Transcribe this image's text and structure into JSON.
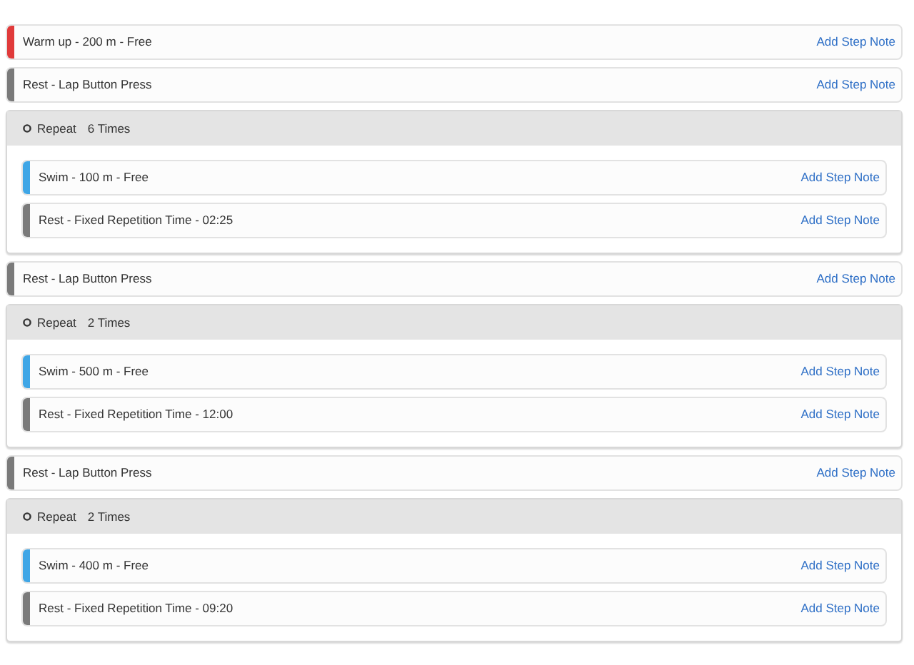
{
  "workout": [
    {
      "kind": "step",
      "label": "Warm up - 200 m - Free",
      "color": "#e03a3a",
      "note_link": "Add Step Note"
    },
    {
      "kind": "step",
      "label": "Rest - Lap Button Press",
      "color": "#7a7a7a",
      "note_link": "Add Step Note"
    },
    {
      "kind": "repeat",
      "label": "Repeat",
      "count": "6 Times",
      "children": [
        {
          "kind": "step",
          "label": "Swim - 100 m - Free",
          "color": "#3fa6e6",
          "note_link": "Add Step Note"
        },
        {
          "kind": "step",
          "label": "Rest - Fixed Repetition Time - 02:25",
          "color": "#7a7a7a",
          "note_link": "Add Step Note"
        }
      ]
    },
    {
      "kind": "step",
      "label": "Rest - Lap Button Press",
      "color": "#7a7a7a",
      "note_link": "Add Step Note"
    },
    {
      "kind": "repeat",
      "label": "Repeat",
      "count": "2 Times",
      "children": [
        {
          "kind": "step",
          "label": "Swim - 500 m - Free",
          "color": "#3fa6e6",
          "note_link": "Add Step Note"
        },
        {
          "kind": "step",
          "label": "Rest - Fixed Repetition Time - 12:00",
          "color": "#7a7a7a",
          "note_link": "Add Step Note"
        }
      ]
    },
    {
      "kind": "step",
      "label": "Rest - Lap Button Press",
      "color": "#7a7a7a",
      "note_link": "Add Step Note"
    },
    {
      "kind": "repeat",
      "label": "Repeat",
      "count": "2 Times",
      "children": [
        {
          "kind": "step",
          "label": "Swim - 400 m - Free",
          "color": "#3fa6e6",
          "note_link": "Add Step Note"
        },
        {
          "kind": "step",
          "label": "Rest - Fixed Repetition Time - 09:20",
          "color": "#7a7a7a",
          "note_link": "Add Step Note"
        }
      ]
    }
  ]
}
